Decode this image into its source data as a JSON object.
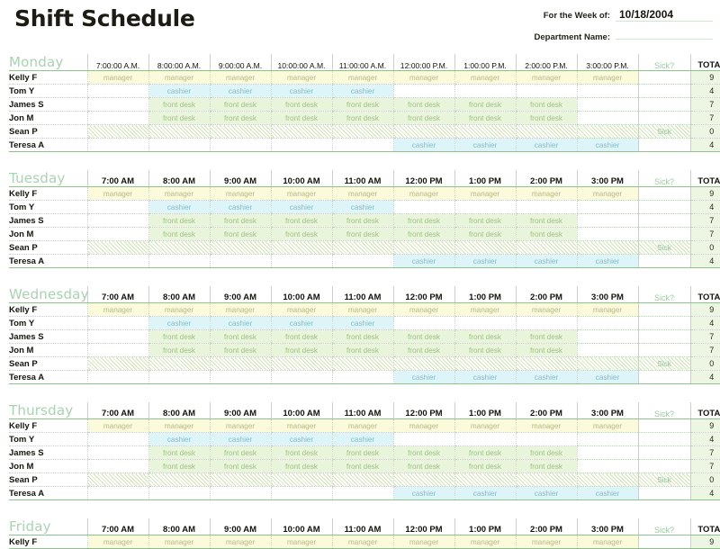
{
  "header": {
    "title": "Shift Schedule",
    "week_label": "For the Week of:",
    "week_value": "10/18/2004",
    "department_label": "Department Name:",
    "department_value": ""
  },
  "columns": {
    "sick_header": "Sick?",
    "total_header": "TOTAL",
    "hours_long": [
      "7:00:00 A.M.",
      "8:00:00 A.M.",
      "9:00:00 A.M.",
      "10:00:00 A.M.",
      "11:00:00 A.M.",
      "12:00:00 P.M.",
      "1:00:00 P.M.",
      "2:00:00 P.M.",
      "3:00:00 P.M."
    ],
    "hours_short": [
      "7:00 AM",
      "8:00 AM",
      "9:00 AM",
      "10:00 AM",
      "11:00 AM",
      "12:00 PM",
      "1:00 PM",
      "2:00 PM",
      "3:00 PM"
    ]
  },
  "roles": {
    "manager": "manager",
    "cashier": "cashier",
    "front_desk": "front desk",
    "sick": "Sick"
  },
  "colors": {
    "manager_bg": "#fbfadb",
    "cashier_bg": "#ddf4f8",
    "front_desk_bg": "#e9f5db",
    "total_bg": "#edf6e3",
    "day_title": "#a8d3b0",
    "grid_line": "#8cc48c"
  },
  "days": [
    {
      "name": "Monday",
      "time_format": "long",
      "rows": [
        {
          "employee": "Kelly F",
          "shifts": [
            "manager",
            "manager",
            "manager",
            "manager",
            "manager",
            "manager",
            "manager",
            "manager",
            "manager"
          ],
          "sick": "",
          "total": "9"
        },
        {
          "employee": "Tom Y",
          "shifts": [
            "",
            "cashier",
            "cashier",
            "cashier",
            "cashier",
            "",
            "",
            "",
            ""
          ],
          "sick": "",
          "total": "4"
        },
        {
          "employee": "James S",
          "shifts": [
            "",
            "front desk",
            "front desk",
            "front desk",
            "front desk",
            "front desk",
            "front desk",
            "front desk",
            ""
          ],
          "sick": "",
          "total": "7"
        },
        {
          "employee": "Jon M",
          "shifts": [
            "",
            "front desk",
            "front desk",
            "front desk",
            "front desk",
            "front desk",
            "front desk",
            "front desk",
            ""
          ],
          "sick": "",
          "total": "7"
        },
        {
          "employee": "Sean P",
          "shifts": [
            "sick",
            "sick",
            "sick",
            "sick",
            "sick",
            "sick",
            "sick",
            "sick",
            "sick"
          ],
          "sick": "Sick",
          "total": "0"
        },
        {
          "employee": "Teresa A",
          "shifts": [
            "",
            "",
            "",
            "",
            "",
            "cashier",
            "cashier",
            "cashier",
            "cashier"
          ],
          "sick": "",
          "total": "4"
        }
      ]
    },
    {
      "name": "Tuesday",
      "time_format": "short",
      "rows": [
        {
          "employee": "Kelly F",
          "shifts": [
            "manager",
            "manager",
            "manager",
            "manager",
            "manager",
            "manager",
            "manager",
            "manager",
            "manager"
          ],
          "sick": "",
          "total": "9"
        },
        {
          "employee": "Tom Y",
          "shifts": [
            "",
            "cashier",
            "cashier",
            "cashier",
            "cashier",
            "",
            "",
            "",
            ""
          ],
          "sick": "",
          "total": "4"
        },
        {
          "employee": "James S",
          "shifts": [
            "",
            "front desk",
            "front desk",
            "front desk",
            "front desk",
            "front desk",
            "front desk",
            "front desk",
            ""
          ],
          "sick": "",
          "total": "7"
        },
        {
          "employee": "Jon M",
          "shifts": [
            "",
            "front desk",
            "front desk",
            "front desk",
            "front desk",
            "front desk",
            "front desk",
            "front desk",
            ""
          ],
          "sick": "",
          "total": "7"
        },
        {
          "employee": "Sean P",
          "shifts": [
            "sick",
            "sick",
            "sick",
            "sick",
            "sick",
            "sick",
            "sick",
            "sick",
            "sick"
          ],
          "sick": "Sick",
          "total": "0"
        },
        {
          "employee": "Teresa A",
          "shifts": [
            "",
            "",
            "",
            "",
            "",
            "cashier",
            "cashier",
            "cashier",
            "cashier"
          ],
          "sick": "",
          "total": "4"
        }
      ]
    },
    {
      "name": "Wednesday",
      "time_format": "short",
      "rows": [
        {
          "employee": "Kelly F",
          "shifts": [
            "manager",
            "manager",
            "manager",
            "manager",
            "manager",
            "manager",
            "manager",
            "manager",
            "manager"
          ],
          "sick": "",
          "total": "9"
        },
        {
          "employee": "Tom Y",
          "shifts": [
            "",
            "cashier",
            "cashier",
            "cashier",
            "cashier",
            "",
            "",
            "",
            ""
          ],
          "sick": "",
          "total": "4"
        },
        {
          "employee": "James S",
          "shifts": [
            "",
            "front desk",
            "front desk",
            "front desk",
            "front desk",
            "front desk",
            "front desk",
            "front desk",
            ""
          ],
          "sick": "",
          "total": "7"
        },
        {
          "employee": "Jon M",
          "shifts": [
            "",
            "front desk",
            "front desk",
            "front desk",
            "front desk",
            "front desk",
            "front desk",
            "front desk",
            ""
          ],
          "sick": "",
          "total": "7"
        },
        {
          "employee": "Sean P",
          "shifts": [
            "sick",
            "sick",
            "sick",
            "sick",
            "sick",
            "sick",
            "sick",
            "sick",
            "sick"
          ],
          "sick": "Sick",
          "total": "0"
        },
        {
          "employee": "Teresa A",
          "shifts": [
            "",
            "",
            "",
            "",
            "",
            "cashier",
            "cashier",
            "cashier",
            "cashier"
          ],
          "sick": "",
          "total": "4"
        }
      ]
    },
    {
      "name": "Thursday",
      "time_format": "short",
      "rows": [
        {
          "employee": "Kelly F",
          "shifts": [
            "manager",
            "manager",
            "manager",
            "manager",
            "manager",
            "manager",
            "manager",
            "manager",
            "manager"
          ],
          "sick": "",
          "total": "9"
        },
        {
          "employee": "Tom Y",
          "shifts": [
            "",
            "cashier",
            "cashier",
            "cashier",
            "cashier",
            "",
            "",
            "",
            ""
          ],
          "sick": "",
          "total": "4"
        },
        {
          "employee": "James S",
          "shifts": [
            "",
            "front desk",
            "front desk",
            "front desk",
            "front desk",
            "front desk",
            "front desk",
            "front desk",
            ""
          ],
          "sick": "",
          "total": "7"
        },
        {
          "employee": "Jon M",
          "shifts": [
            "",
            "front desk",
            "front desk",
            "front desk",
            "front desk",
            "front desk",
            "front desk",
            "front desk",
            ""
          ],
          "sick": "",
          "total": "7"
        },
        {
          "employee": "Sean P",
          "shifts": [
            "sick",
            "sick",
            "sick",
            "sick",
            "sick",
            "sick",
            "sick",
            "sick",
            "sick"
          ],
          "sick": "Sick",
          "total": "0"
        },
        {
          "employee": "Teresa A",
          "shifts": [
            "",
            "",
            "",
            "",
            "",
            "cashier",
            "cashier",
            "cashier",
            "cashier"
          ],
          "sick": "",
          "total": "4"
        }
      ]
    },
    {
      "name": "Friday",
      "time_format": "short",
      "rows": [
        {
          "employee": "Kelly F",
          "shifts": [
            "manager",
            "manager",
            "manager",
            "manager",
            "manager",
            "manager",
            "manager",
            "manager",
            "manager"
          ],
          "sick": "",
          "total": "9"
        }
      ]
    }
  ]
}
